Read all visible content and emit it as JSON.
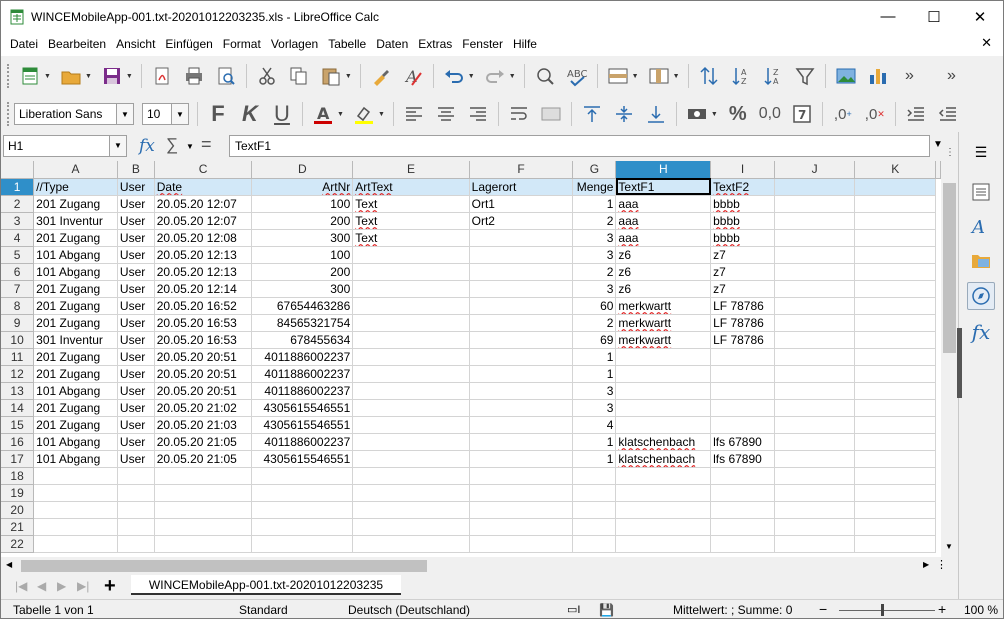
{
  "window": {
    "title": "WINCEMobileApp-001.txt-20201012203235.xls - LibreOffice Calc",
    "minimize": "—",
    "maximize": "☐",
    "close": "✕"
  },
  "menu": {
    "items": [
      "Datei",
      "Bearbeiten",
      "Ansicht",
      "Einfügen",
      "Format",
      "Vorlagen",
      "Tabelle",
      "Daten",
      "Extras",
      "Fenster",
      "Hilfe"
    ],
    "close_doc": "✕"
  },
  "format_toolbar": {
    "font_name": "Liberation Sans",
    "font_size": "10"
  },
  "formula_bar": {
    "cell_ref": "H1",
    "formula": "TextF1",
    "fx": "fx",
    "sigma": "∑",
    "equals": "="
  },
  "grid": {
    "columns": [
      "A",
      "B",
      "C",
      "D",
      "E",
      "F",
      "G",
      "H",
      "I",
      "J",
      "K"
    ],
    "selected_column": "H",
    "selected_row": "1",
    "rows": [
      [
        "1",
        "//Type",
        "User",
        "Date",
        "ArtNr",
        "ArtText",
        "Lagerort",
        "Menge",
        "TextF1",
        "TextF2",
        "",
        ""
      ],
      [
        "2",
        "201 Zugang",
        "User",
        "20.05.20 12:07",
        "100",
        "Text",
        "Ort1",
        "1",
        "aaa",
        "bbbb",
        "",
        ""
      ],
      [
        "3",
        "301 Inventur",
        "User",
        "20.05.20 12:07",
        "200",
        "Text",
        "Ort2",
        "2",
        "aaa",
        "bbbb",
        "",
        ""
      ],
      [
        "4",
        "201 Zugang",
        "User",
        "20.05.20 12:08",
        "300",
        "Text",
        "",
        "3",
        "aaa",
        "bbbb",
        "",
        ""
      ],
      [
        "5",
        "101 Abgang",
        "User",
        "20.05.20 12:13",
        "100",
        "",
        "",
        "3",
        "z6",
        "z7",
        "",
        ""
      ],
      [
        "6",
        "101 Abgang",
        "User",
        "20.05.20 12:13",
        "200",
        "",
        "",
        "2",
        "z6",
        "z7",
        "",
        ""
      ],
      [
        "7",
        "201 Zugang",
        "User",
        "20.05.20 12:14",
        "300",
        "",
        "",
        "3",
        "z6",
        "z7",
        "",
        ""
      ],
      [
        "8",
        "201 Zugang",
        "User",
        "20.05.20 16:52",
        "67654463286",
        "",
        "",
        "60",
        "merkwartt",
        "LF 78786",
        "",
        ""
      ],
      [
        "9",
        "201 Zugang",
        "User",
        "20.05.20 16:53",
        "84565321754",
        "",
        "",
        "2",
        "merkwartt",
        "LF 78786",
        "",
        ""
      ],
      [
        "10",
        "301 Inventur",
        "User",
        "20.05.20 16:53",
        "678455634",
        "",
        "",
        "69",
        "merkwartt",
        "LF 78786",
        "",
        ""
      ],
      [
        "11",
        "201 Zugang",
        "User",
        "20.05.20 20:51",
        "4011886002237",
        "",
        "",
        "1",
        "",
        "",
        "",
        ""
      ],
      [
        "12",
        "201 Zugang",
        "User",
        "20.05.20 20:51",
        "4011886002237",
        "",
        "",
        "1",
        "",
        "",
        "",
        ""
      ],
      [
        "13",
        "101 Abgang",
        "User",
        "20.05.20 20:51",
        "4011886002237",
        "",
        "",
        "3",
        "",
        "",
        "",
        ""
      ],
      [
        "14",
        "201 Zugang",
        "User",
        "20.05.20 21:02",
        "4305615546551",
        "",
        "",
        "3",
        "",
        "",
        "",
        ""
      ],
      [
        "15",
        "201 Zugang",
        "User",
        "20.05.20 21:03",
        "4305615546551",
        "",
        "",
        "4",
        "",
        "",
        "",
        ""
      ],
      [
        "16",
        "101 Abgang",
        "User",
        "20.05.20 21:05",
        "4011886002237",
        "",
        "",
        "1",
        "klatschenbach",
        "lfs 67890",
        "",
        ""
      ],
      [
        "17",
        "101 Abgang",
        "User",
        "20.05.20 21:05",
        "4305615546551",
        "",
        "",
        "1",
        "klatschenbach",
        "lfs 67890",
        "",
        ""
      ],
      [
        "18",
        "",
        "",
        "",
        "",
        "",
        "",
        "",
        "",
        "",
        "",
        ""
      ],
      [
        "19",
        "",
        "",
        "",
        "",
        "",
        "",
        "",
        "",
        "",
        "",
        ""
      ],
      [
        "20",
        "",
        "",
        "",
        "",
        "",
        "",
        "",
        "",
        "",
        "",
        ""
      ],
      [
        "21",
        "",
        "",
        "",
        "",
        "",
        "",
        "",
        "",
        "",
        "",
        ""
      ],
      [
        "22",
        "",
        "",
        "",
        "",
        "",
        "",
        "",
        "",
        "",
        "",
        ""
      ]
    ]
  },
  "sheet_tabs": {
    "add": "+",
    "active": "WINCEMobileApp-001.txt-20201012203235"
  },
  "status": {
    "sheet": "Tabelle 1 von 1",
    "style": "Standard",
    "language": "Deutsch (Deutschland)",
    "sum": "Mittelwert: ; Summe: 0",
    "zoom_minus": "−",
    "zoom_plus": "+",
    "zoom": "100 %"
  },
  "colors": {
    "selected_header": "#2f8fc9",
    "row_highlight": "#d2e8f8",
    "accent_blue": "#2a6cb0",
    "spell_underline": "#e02020"
  }
}
